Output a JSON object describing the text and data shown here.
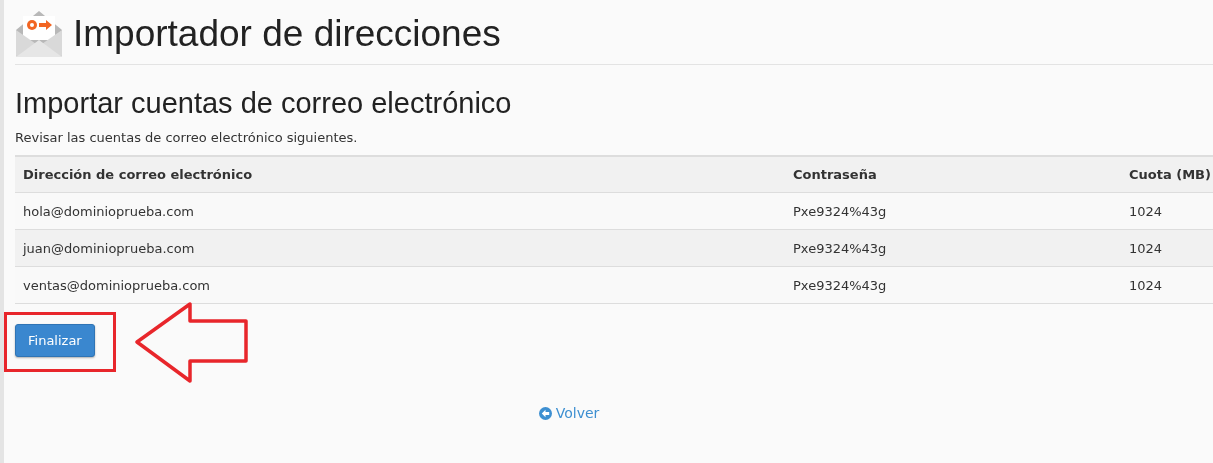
{
  "header": {
    "title": "Importador de direcciones"
  },
  "section": {
    "heading": "Importar cuentas de correo electrónico",
    "description": "Revisar las cuentas de correo electrónico siguientes."
  },
  "table": {
    "columns": [
      "Dirección de correo electrónico",
      "Contraseña",
      "Cuota (MB)"
    ],
    "rows": [
      {
        "cells": [
          "hola@dominioprueba.com",
          "Pxe9324%43g",
          "1024"
        ]
      },
      {
        "cells": [
          "juan@dominioprueba.com",
          "Pxe9324%43g",
          "1024"
        ]
      },
      {
        "cells": [
          "ventas@dominioprueba.com",
          "Pxe9324%43g",
          "1024"
        ]
      }
    ]
  },
  "finish_button": {
    "label": "Finalizar"
  },
  "back_link": {
    "label": "Volver"
  }
}
